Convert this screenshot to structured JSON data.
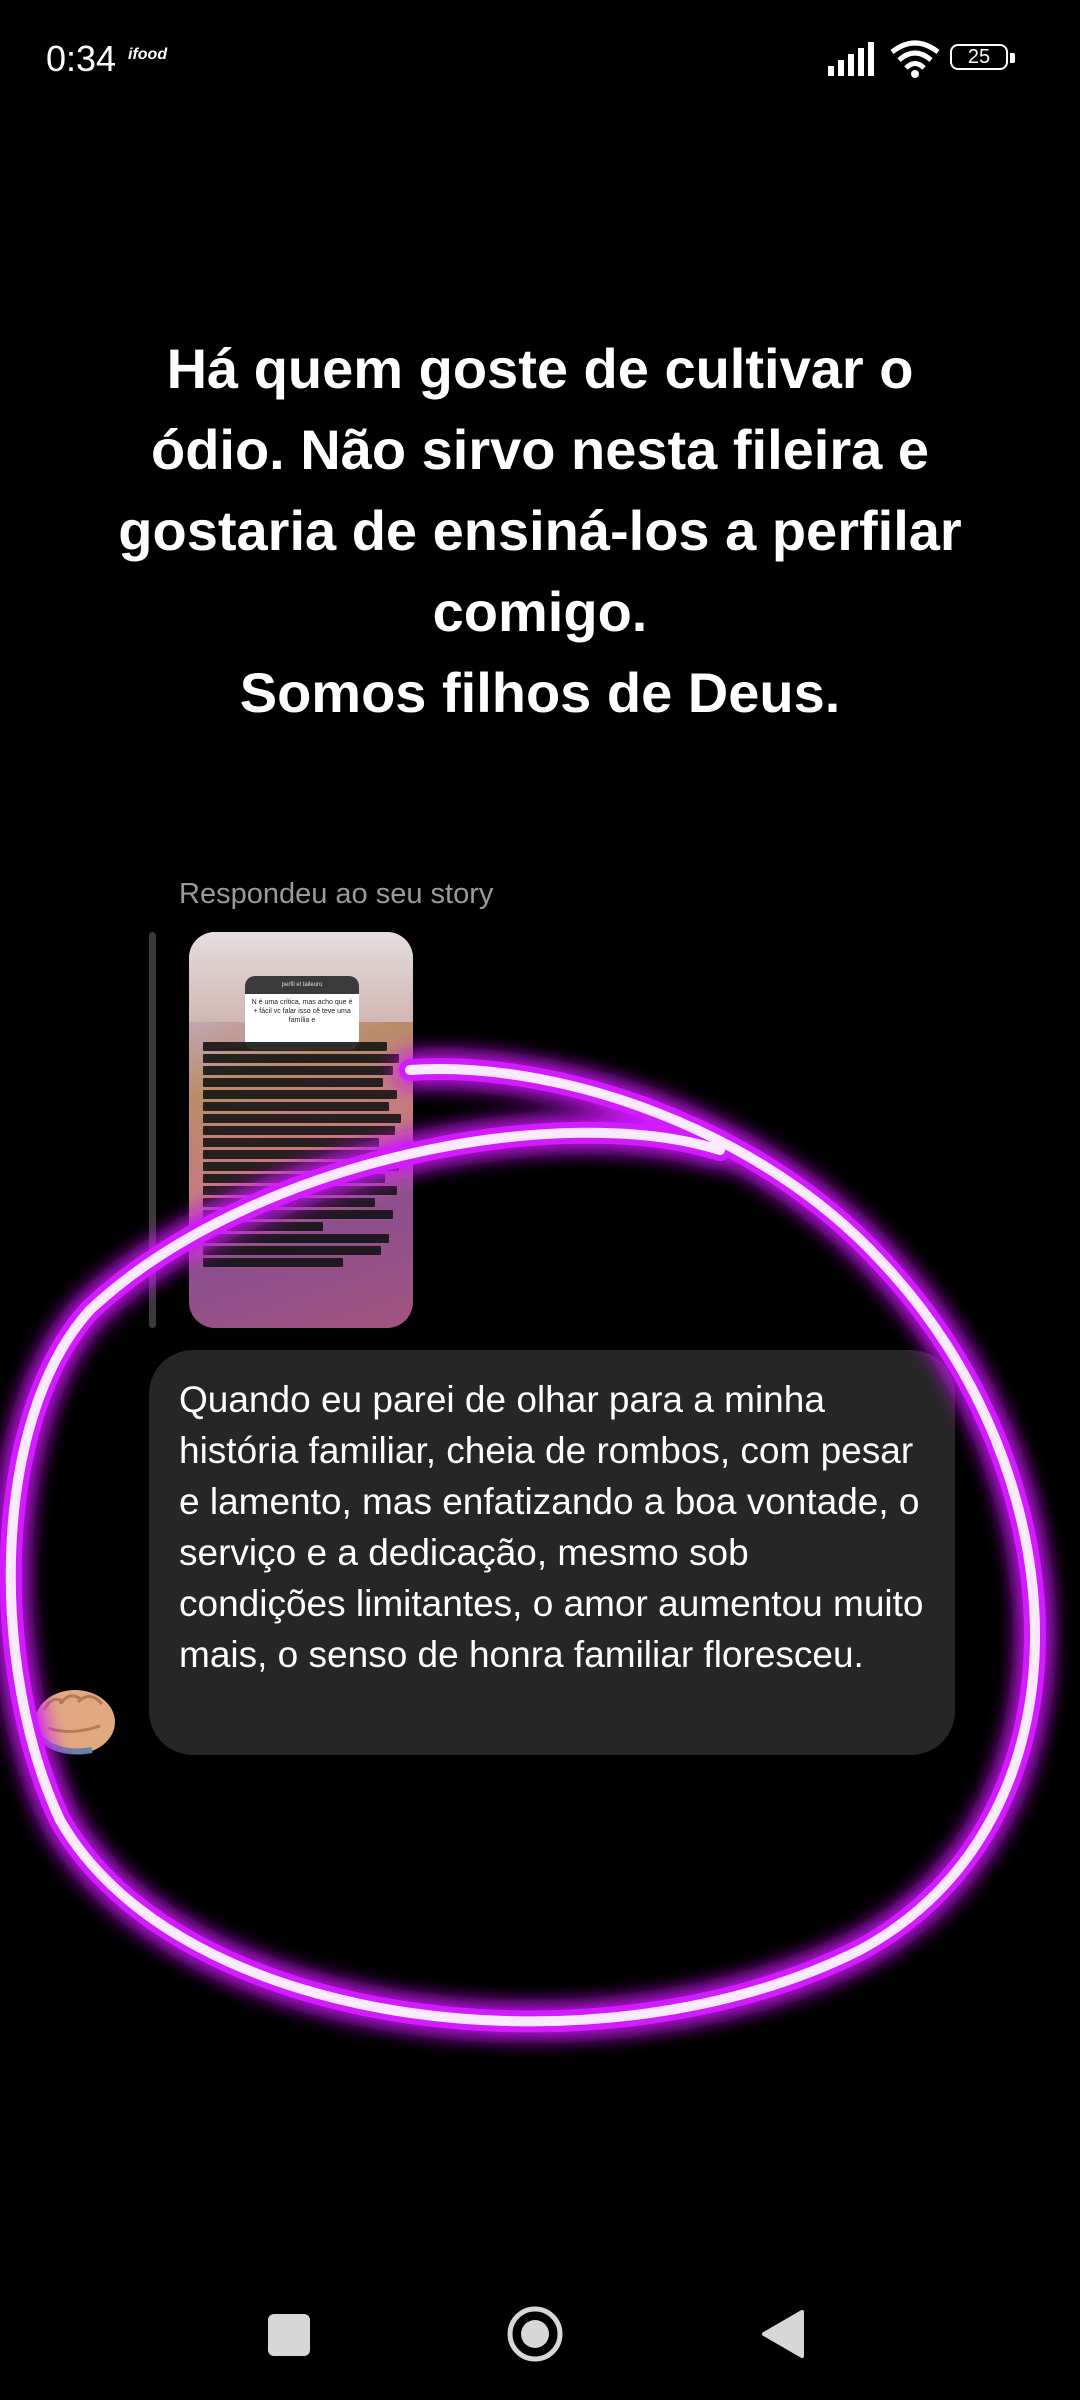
{
  "status_bar": {
    "time": "0:34",
    "app_badge": "ifood",
    "battery_level": "25"
  },
  "headline": {
    "lines": [
      "Há quem goste de cultivar o",
      "ódio. Não sirvo nesta fileira e",
      "gostaria de ensiná-los a perfilar",
      "comigo.",
      "Somos filhos de Deus."
    ]
  },
  "reply": {
    "label": "Respondeu ao seu story",
    "story_question_header": "perfil el taileuro",
    "story_question_text": "N é uma crítica, mas acho que é + fácil vc falar isso cê teve uma família e"
  },
  "message": {
    "text": "Quando eu parei de olhar para a minha história familiar, cheia de rombos, com pesar e lamento, mas enfatizando a boa vontade, o serviço e a dedicação, mesmo sob condições limitantes, o amor aumentou muito mais, o senso de honra familiar floresceu."
  },
  "colors": {
    "background": "#000000",
    "bubble": "#262626",
    "neon_glow": "#d21bff"
  },
  "icons": {
    "avatar": "fist-emoji-icon",
    "nav_recents": "square-icon",
    "nav_home": "circle-icon",
    "nav_back": "triangle-back-icon"
  }
}
